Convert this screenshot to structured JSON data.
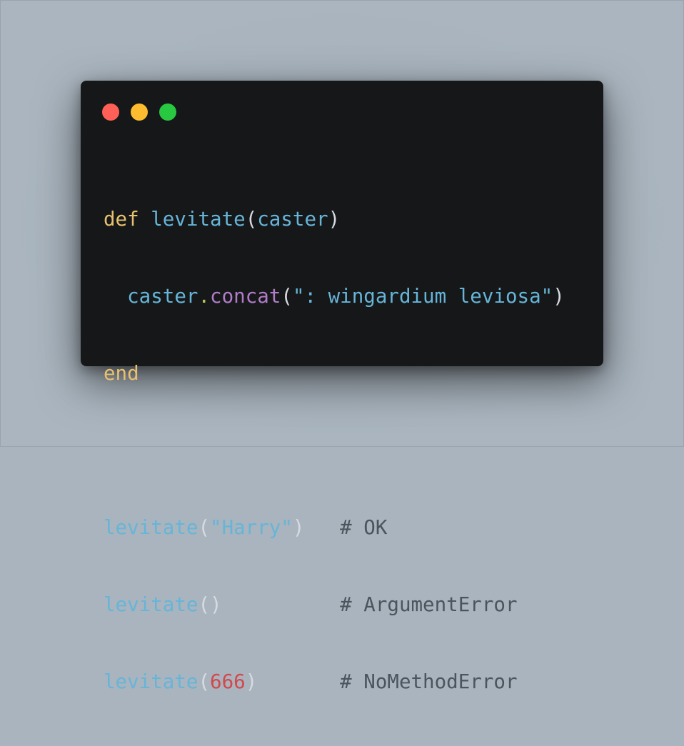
{
  "colors": {
    "background": "#a9b4be",
    "window": "#161719",
    "close_dot": "#fe5f57",
    "minimize_dot": "#febc2e",
    "maximize_dot": "#28c840"
  },
  "window_controls": [
    "close",
    "minimize",
    "maximize"
  ],
  "code": {
    "line1": {
      "kw": "def",
      "fn": "levitate",
      "open": "(",
      "arg": "caster",
      "close": ")"
    },
    "line2": {
      "indent": "  ",
      "recv": "caster",
      "dot": ".",
      "method": "concat",
      "open": "(",
      "str": "\": wingardium leviosa\"",
      "close": ")"
    },
    "line3": {
      "kw": "end"
    },
    "line5": {
      "fn": "levitate",
      "open": "(",
      "str": "\"Harry\"",
      "close": ")",
      "pad": "   ",
      "comment": "# OK"
    },
    "line6": {
      "fn": "levitate",
      "parens": "()",
      "pad": "          ",
      "comment": "# ArgumentError"
    },
    "line7": {
      "fn": "levitate",
      "open": "(",
      "num": "666",
      "close": ")",
      "pad": "       ",
      "comment": "# NoMethodError"
    }
  }
}
